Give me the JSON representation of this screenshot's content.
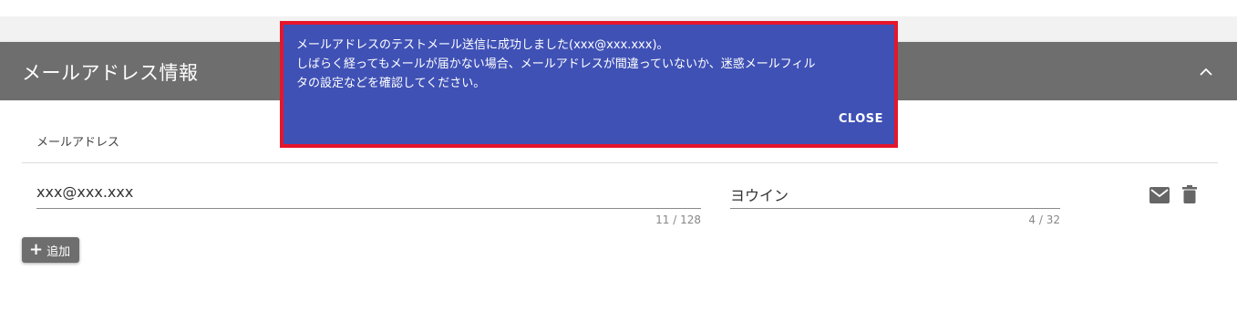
{
  "section": {
    "title": "メールアドレス情報",
    "collapse_icon": "chevron-up-icon"
  },
  "table": {
    "column_header": "メールアドレス"
  },
  "row": {
    "email_value": "xxx@xxx.xxx",
    "email_counter": "11 / 128",
    "name_value": "ヨウイン",
    "name_counter": "4 / 32",
    "send_icon": "mail-icon",
    "delete_icon": "trash-icon"
  },
  "add_button": {
    "label": "追加"
  },
  "snackbar": {
    "line1": "メールアドレスのテストメール送信に成功しました(xxx@xxx.xxx)。",
    "line2": "しばらく経ってもメールが届かない場合、メールアドレスが間違っていないか、迷惑メールフィル",
    "line3": "タの設定などを確認してください。",
    "close_label": "CLOSE",
    "background_color": "#3f51b5",
    "highlight_color": "#e5162b"
  },
  "colors": {
    "header_bg": "#6e6e6e",
    "page_bg": "#ffffff"
  }
}
